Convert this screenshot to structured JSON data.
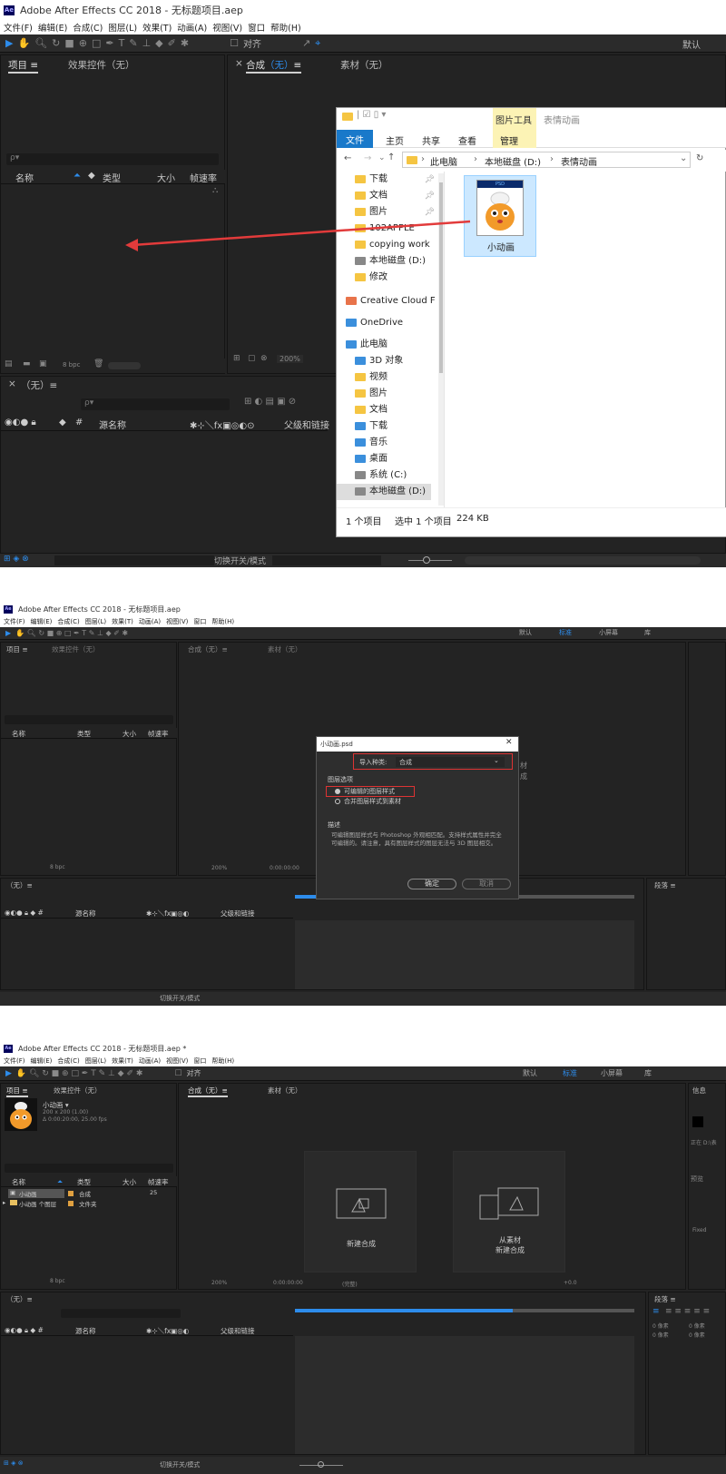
{
  "shot1": {
    "title": "Adobe After Effects CC 2018 - 无标题项目.aep",
    "menu": [
      "文件(F)",
      "编辑(E)",
      "合成(C)",
      "图层(L)",
      "效果(T)",
      "动画(A)",
      "视图(V)",
      "窗口",
      "帮助(H)"
    ],
    "toolbar_align": "对齐",
    "toolbar_workspace": "默认",
    "project_tab": "项目 ≡",
    "effects_tab": "效果控件（无）",
    "comp_tab_x": "×",
    "comp_tab_label": "合成",
    "comp_tab_none": "（无）",
    "comp_tab_menu": "≡",
    "footage_tab": "素材（无）",
    "search_glyph": "ρ▾",
    "col_name": "名称",
    "col_type": "类型",
    "col_size": "大小",
    "col_fps": "帧速率",
    "bpc": "8 bpc",
    "zoom": "200%",
    "timeline_tab": "（无）≡",
    "layer_col_source": "源名称",
    "layer_col_parent": "父级和链接",
    "switch_mode": "切换开关/模式",
    "explorer": {
      "ribbon_tools": "图片工具",
      "folder_title": "表情动画",
      "tab_file": "文件",
      "tab_home": "主页",
      "tab_share": "共享",
      "tab_view": "查看",
      "tab_manage": "管理",
      "address": [
        "此电脑",
        "本地磁盘 (D:)",
        "表情动画"
      ],
      "nav": [
        "下载",
        "文档",
        "图片",
        "102APPLE",
        "copying work",
        "本地磁盘 (D:)",
        "修改",
        "Creative Cloud F",
        "OneDrive",
        "此电脑",
        "3D 对象",
        "视频",
        "图片",
        "文档",
        "下载",
        "音乐",
        "桌面",
        "系统 (C:)",
        "本地磁盘 (D:)"
      ],
      "file_badge": "PSD",
      "file_name": "小动画",
      "status_count": "1 个项目",
      "status_selected": "选中 1 个项目",
      "status_size": "224 KB"
    }
  },
  "shot2": {
    "title": "Adobe After Effects CC 2018 - 无标题项目.aep",
    "menu": [
      "文件(F)",
      "编辑(E)",
      "合成(C)",
      "图层(L)",
      "效果(T)",
      "动画(A)",
      "视图(V)",
      "窗口",
      "帮助(H)"
    ],
    "ws_default": "默认",
    "ws_standard": "标准",
    "ws_small": "小屏幕",
    "ws_lib": "库",
    "project_tab": "项目 ≡",
    "effects_tab": "效果控件（无）",
    "comp_tab": "合成（无）≡",
    "footage_tab": "素材（无）",
    "col_name": "名称",
    "col_type": "类型",
    "col_size": "大小",
    "col_fps": "帧速率",
    "timeline_tab": "（无）≡",
    "layer_col_source": "源名称",
    "layer_col_parent": "父级和链接",
    "switch_mode": "切换开关/模式",
    "para_tab": "段落 ≡",
    "bpc": "8 bpc",
    "zoom": "200%",
    "time": "0:00:00:00",
    "dialog": {
      "title": "小动画.psd",
      "import_label": "导入种类:",
      "import_value": "合成",
      "layer_options": "图层选项",
      "opt1": "可编辑的图层样式",
      "opt2": "合并图层样式到素材",
      "desc_title": "描述",
      "desc_text": "可编辑图层样式与 Photoshop 外观相匹配。支持样式属性并完全可编辑的。请注意，具有图层样式的图层无法与 3D 图层相交。",
      "ok": "确定",
      "cancel": "取消"
    },
    "bg_text1": "材",
    "bg_text2": "成"
  },
  "shot3": {
    "title": "Adobe After Effects CC 2018 - 无标题项目.aep *",
    "menu": [
      "文件(F)",
      "编辑(E)",
      "合成(C)",
      "图层(L)",
      "效果(T)",
      "动画(A)",
      "视图(V)",
      "窗口",
      "帮助(H)"
    ],
    "toolbar_align": "对齐",
    "ws_default": "默认",
    "ws_standard": "标准",
    "ws_small": "小屏幕",
    "ws_lib": "库",
    "info_tab": "信息",
    "project_tab": "项目 ≡",
    "effects_tab": "效果控件（无）",
    "comp_tab": "合成（无）≡",
    "footage_tab": "素材（无）",
    "item_name": "小动画 ▾",
    "item_dims": "200 x 200 (1.00)",
    "item_dur": "Δ 0:00:20:00, 25.00 fps",
    "col_name": "名称",
    "col_type": "类型",
    "col_size": "大小",
    "col_fps": "帧速率",
    "row1_name": "小动画",
    "row1_type": "合成",
    "row1_fps": "25",
    "row2_name": "小动画 个图层",
    "row2_type": "文件夹",
    "new_comp": "新建合成",
    "from_footage_1": "从素材",
    "from_footage_2": "新建合成",
    "bpc": "8 bpc",
    "zoom": "200%",
    "time": "0:00:00:00",
    "res": "(完整)",
    "offset": "+0.0",
    "timeline_tab": "（无）≡",
    "layer_col_source": "源名称",
    "layer_col_parent": "父级和链接",
    "switch_mode": "切换开关/模式",
    "para_tab": "段落 ≡",
    "px1": "0 像素",
    "px2": "0 像素",
    "px3": "0 像素",
    "px4": "0 像素",
    "side_preview": "预览",
    "side_fixed": "Fixed",
    "side_d": "正在 D:\\表"
  }
}
